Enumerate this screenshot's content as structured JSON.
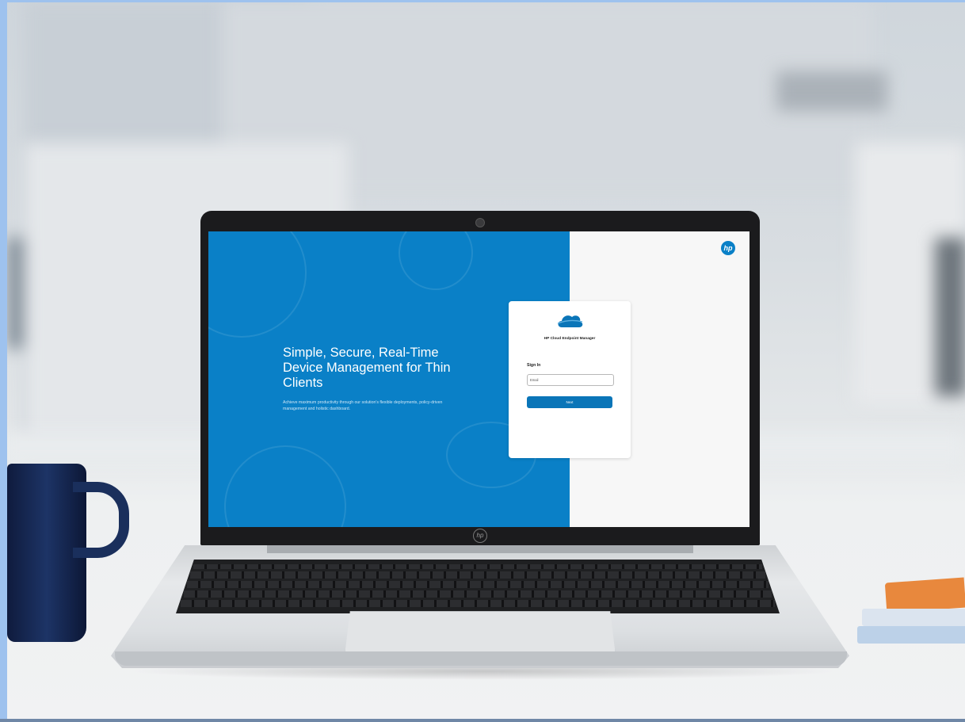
{
  "login_page": {
    "headline": "Simple, Secure, Real-Time Device Management for Thin Clients",
    "subtext": "Achieve maximum productivity through our solution's flexible deployments, policy-driven management and holistic dashboard.",
    "brand_logo": "hp",
    "product_name": "HP Cloud Endpoint Manager",
    "sign_in_title": "Sign In",
    "email_placeholder": "Email",
    "email_value": "",
    "next_button_label": "Next",
    "product_icon": "cloud-icon"
  },
  "laptop": {
    "lid_logo": "hp"
  },
  "colors": {
    "brand_blue": "#0a80c7",
    "button_blue": "#0a75b8",
    "right_panel": "#f7f7f7"
  }
}
